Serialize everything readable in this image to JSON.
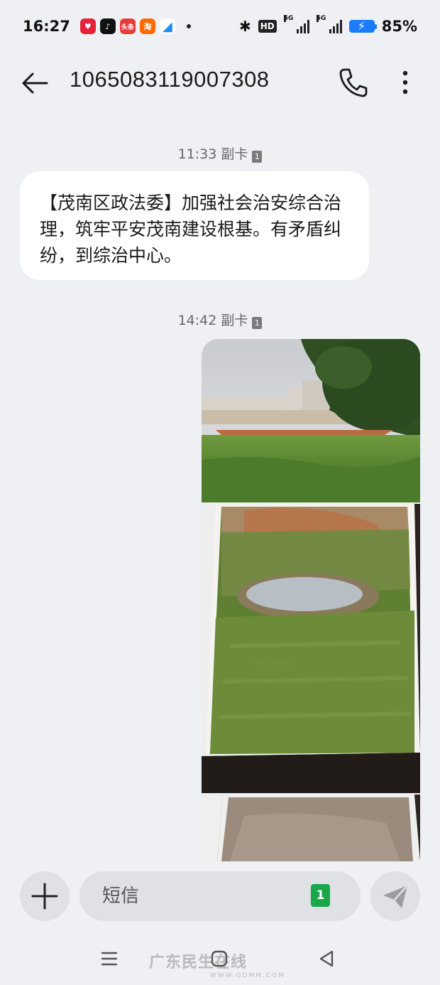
{
  "status_bar": {
    "time": "16:27",
    "battery": "85%",
    "network_1": "5G",
    "network_2": "5G",
    "hd_label": "HD",
    "app_icons": [
      "pinduoduo-icon",
      "douyin-icon",
      "toutiao-icon",
      "taobao-icon",
      "feishu-icon"
    ]
  },
  "header": {
    "title": "1065083119007308"
  },
  "messages": [
    {
      "direction": "incoming",
      "time": "11:33",
      "sim": "副卡",
      "sim_slot": "1",
      "text": "【茂南区政法委】加强社会治安综合治理，筑牢平安茂南建设根基。有矛盾纠纷，到综治中心。"
    },
    {
      "direction": "outgoing",
      "time": "14:42",
      "sim": "副卡",
      "sim_slot": "1",
      "images": [
        "photo-grass-field-with-buildings",
        "photo-printed-grass-with-puddle",
        "photo-dirt-ground"
      ]
    }
  ],
  "composer": {
    "placeholder": "短信",
    "sim_slot": "1"
  },
  "watermark": {
    "text": "广东民生在线",
    "url": "WWW.GDMM.COM"
  },
  "colors": {
    "background": "#eef0f3",
    "bubble": "#ffffff",
    "sim_badge": "#18a84a",
    "battery": "#1a7cff"
  }
}
